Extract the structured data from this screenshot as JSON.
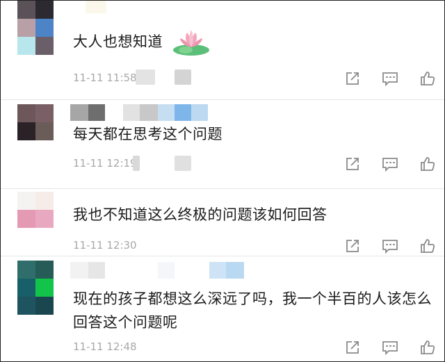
{
  "comments": [
    {
      "text": "大人也想知道",
      "time": "11-11 11:58",
      "avatar_colors": [
        "#5a5258",
        "#2c2a30",
        "#b8a0a6",
        "#4d84c8",
        "#b7e6ec",
        "#6a5e68"
      ],
      "has_lotus": true
    },
    {
      "text": "每天都在思考这个问题",
      "time": "11-11 12:19",
      "avatar_colors": [
        "#6e575a",
        "#7a6066",
        "#2a2226",
        "#6a5c58"
      ],
      "name_colors": [
        "#a6a6a6",
        "#6e6e6e",
        "#e2e2e2",
        "#c8c8c8",
        "#c6def2",
        "#7eb6ea",
        "#bcd9f1"
      ]
    },
    {
      "text": "我也不知道这么终极的问题该如何回答",
      "time": "11-11 12:30",
      "avatar_colors": [
        "#f5f2f2",
        "#f6ece8",
        "#e59ab4",
        "#e8a9c0"
      ]
    },
    {
      "text": "现在的孩子都想这么深远了吗，我一个半百的人该怎么回答这个问题呢",
      "time": "11-11 12:48",
      "avatar_colors": [
        "#2f6e6a",
        "#255c58",
        "#17606a",
        "#12c44a",
        "#1e5460",
        "#1a4650"
      ],
      "name_colors": [
        "#f2f2f2",
        "#e6e6e6",
        "#f4f6fa",
        "#cfe3f6",
        "#b9d8f2"
      ]
    }
  ],
  "icons": {
    "share": "share-icon",
    "reply": "comment-icon",
    "like": "thumbs-up-icon"
  },
  "colors": {
    "text": "#1a1a1a",
    "time": "#a8a8a8",
    "icon": "#8a8a8a",
    "divider": "#e6e6e6"
  }
}
